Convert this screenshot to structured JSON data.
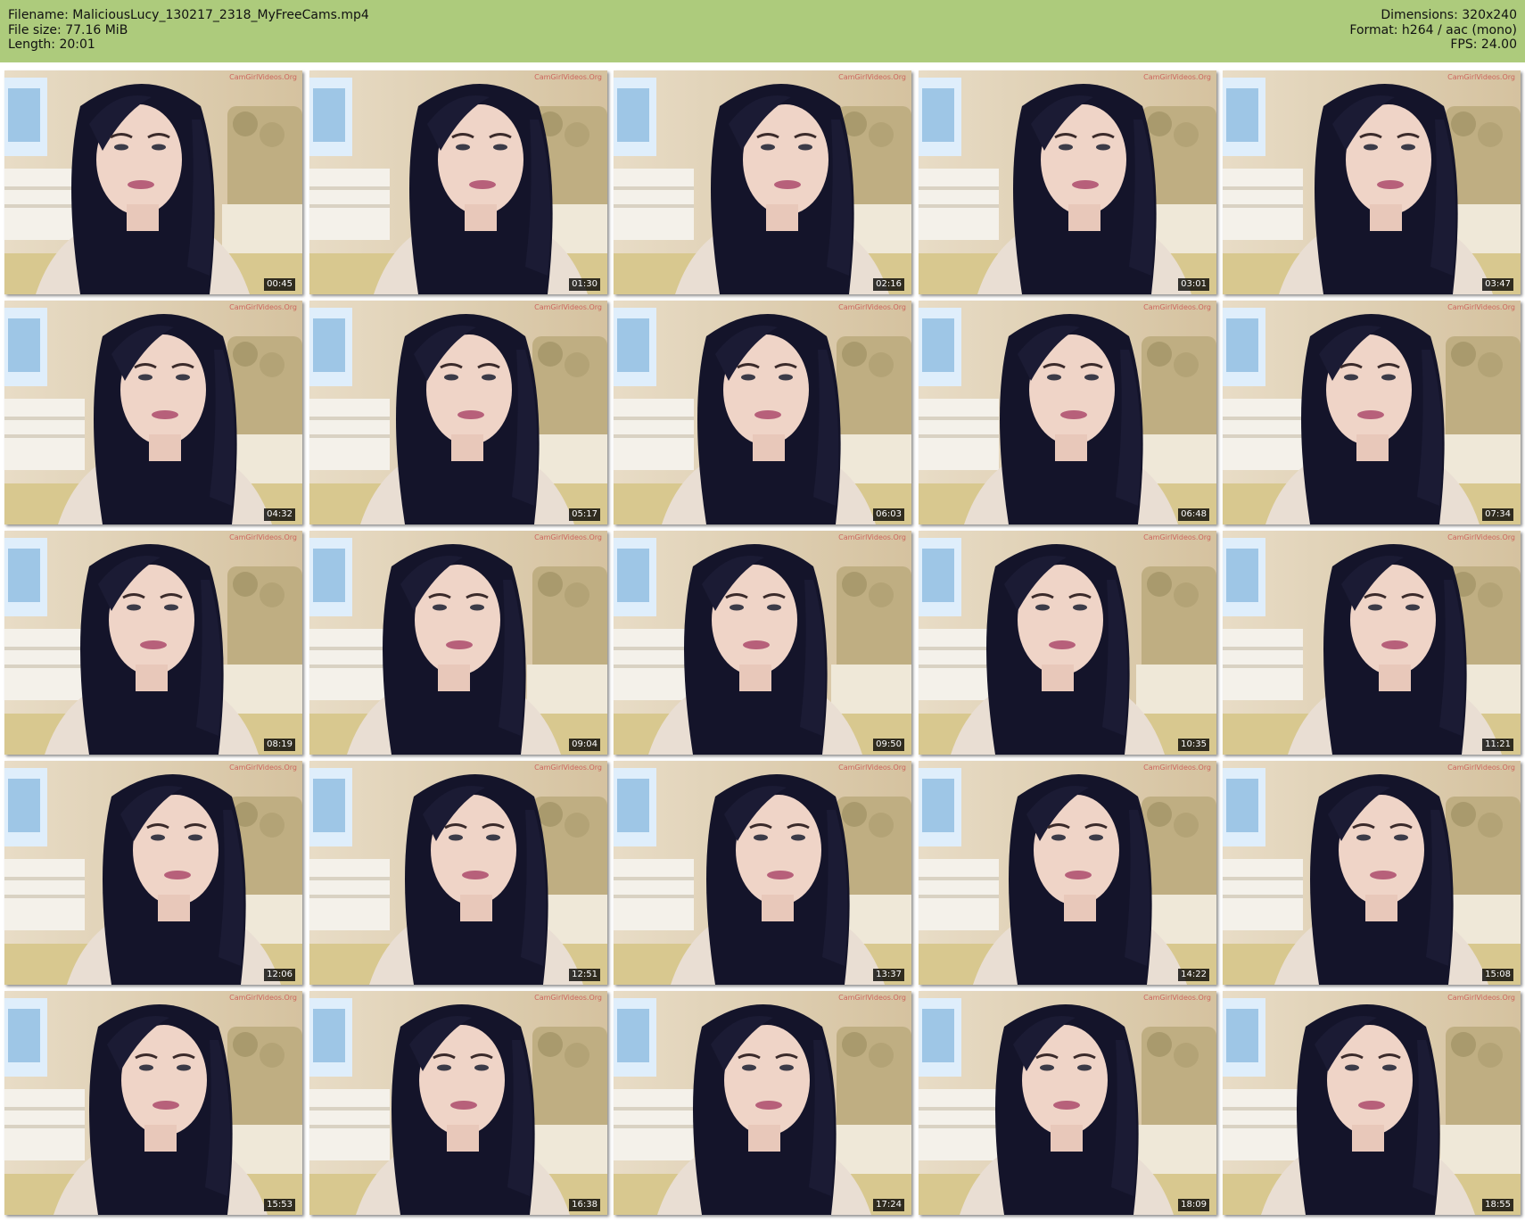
{
  "header": {
    "filename_line": "Filename: MaliciousLucy_130217_2318_MyFreeCams.mp4",
    "filesize_line": "File size: 77.16 MiB",
    "length_line": "Length: 20:01",
    "dimensions_line": "Dimensions: 320x240",
    "format_line": "Format: h264 / aac (mono)",
    "fps_line": "FPS: 24.00",
    "background_color": "#adcb7c"
  },
  "watermark": "CamGirlVideos.Org",
  "thumbnails": [
    {
      "timestamp": "00:45"
    },
    {
      "timestamp": "01:30"
    },
    {
      "timestamp": "02:16"
    },
    {
      "timestamp": "03:01"
    },
    {
      "timestamp": "03:47"
    },
    {
      "timestamp": "04:32"
    },
    {
      "timestamp": "05:17"
    },
    {
      "timestamp": "06:03"
    },
    {
      "timestamp": "06:48"
    },
    {
      "timestamp": "07:34"
    },
    {
      "timestamp": "08:19"
    },
    {
      "timestamp": "09:04"
    },
    {
      "timestamp": "09:50"
    },
    {
      "timestamp": "10:35"
    },
    {
      "timestamp": "11:21"
    },
    {
      "timestamp": "12:06"
    },
    {
      "timestamp": "12:51"
    },
    {
      "timestamp": "13:37"
    },
    {
      "timestamp": "14:22"
    },
    {
      "timestamp": "15:08"
    },
    {
      "timestamp": "15:53"
    },
    {
      "timestamp": "16:38"
    },
    {
      "timestamp": "17:24"
    },
    {
      "timestamp": "18:09"
    },
    {
      "timestamp": "18:55"
    }
  ]
}
